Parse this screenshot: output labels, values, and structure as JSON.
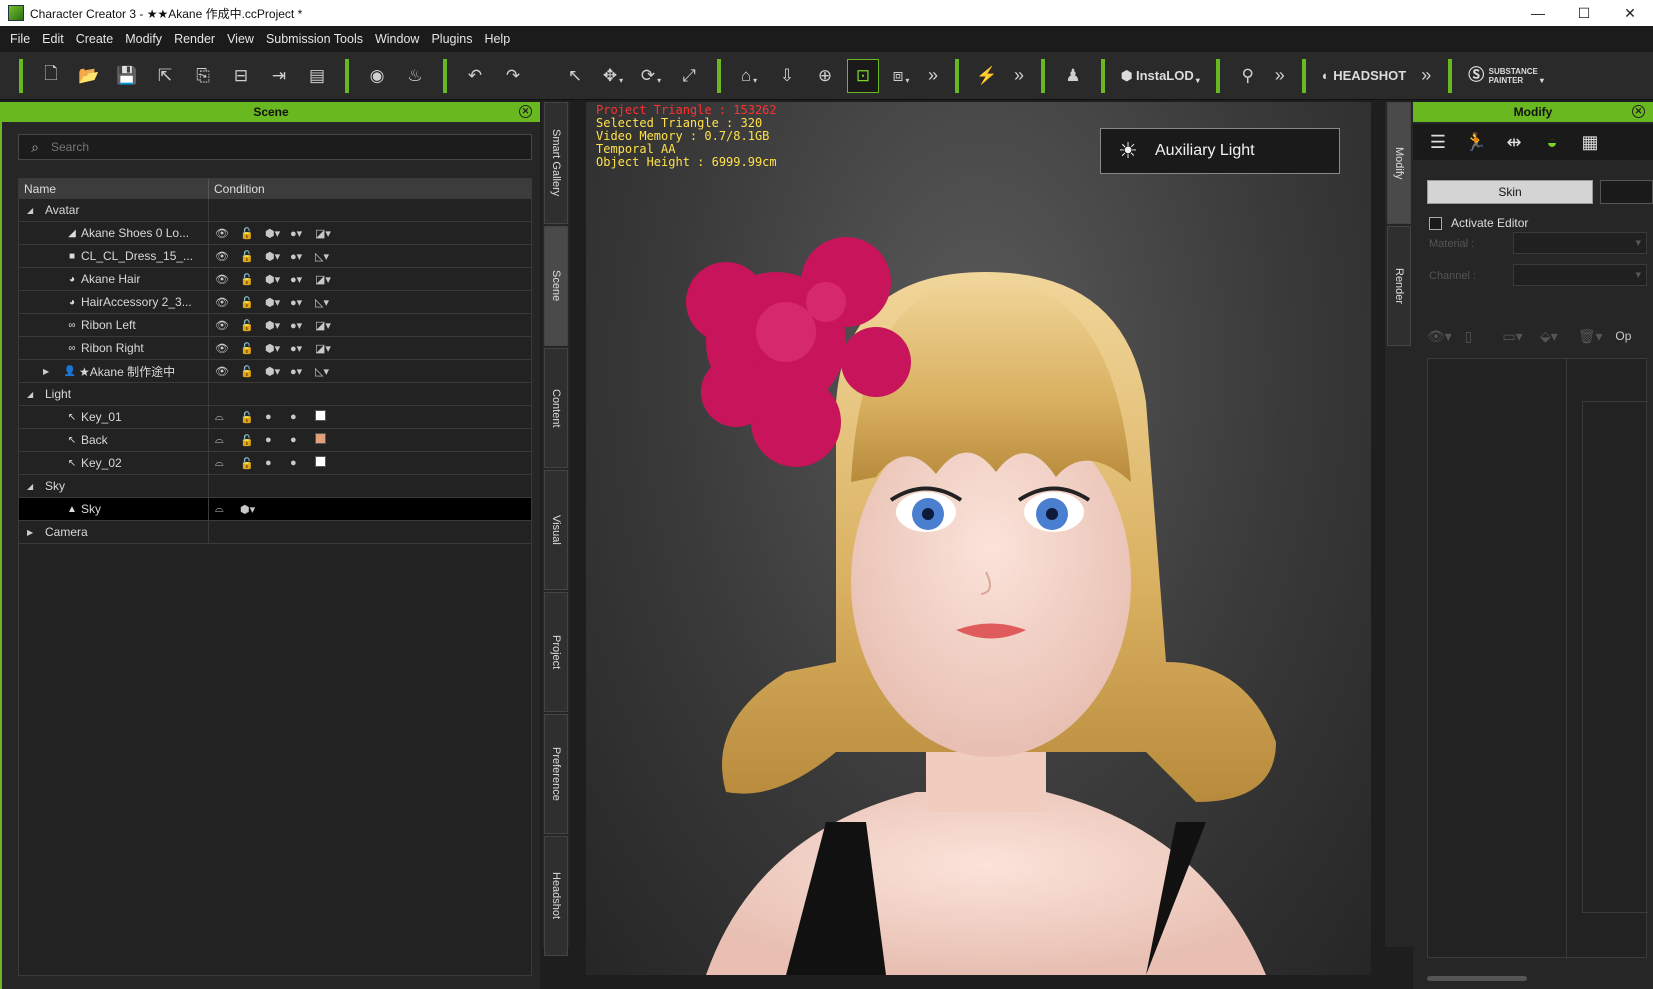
{
  "window": {
    "title": "Character Creator 3 - ★★Akane 作成中.ccProject *",
    "min_icon": "—",
    "max_icon": "☐",
    "close_icon": "✕"
  },
  "menu": [
    "File",
    "Edit",
    "Create",
    "Modify",
    "Render",
    "View",
    "Submission Tools",
    "Window",
    "Plugins",
    "Help"
  ],
  "toolbar": {
    "instalod_label": "InstaLOD",
    "headshot_label": "HEADSHOT",
    "substance_line1": "SUBSTANCE",
    "substance_line2": "PAINTER"
  },
  "scene": {
    "title": "Scene",
    "search_placeholder": "Search",
    "col_name": "Name",
    "col_condition": "Condition",
    "groups": {
      "avatar": "Avatar",
      "light": "Light",
      "sky": "Sky",
      "camera": "Camera"
    },
    "avatar_items": [
      "Akane Shoes 0 Lo...",
      "CL_CL_Dress_15_...",
      "Akane Hair",
      "HairAccessory 2_3...",
      "Ribon Left",
      "Ribon Right",
      "★Akane 制作途中"
    ],
    "light_items": [
      "Key_01",
      "Back",
      "Key_02"
    ],
    "sky_items": [
      "Sky"
    ],
    "light_colors": [
      "#ffffff",
      "#e0a07a",
      "#ffffff"
    ]
  },
  "side_tabs": [
    "Smart Gallery",
    "Scene",
    "Content",
    "Visual",
    "Project",
    "Preference",
    "Headshot"
  ],
  "viewport": {
    "stats": {
      "project_triangle": "Project Triangle : 153262",
      "selected_triangle": "Selected Triangle : 320",
      "video_memory": "Video Memory : 0.7/8.1GB",
      "temporal_aa": "Temporal AA",
      "object_height": "Object Height : 6999.99cm"
    },
    "aux_light": "Auxiliary Light"
  },
  "right_tabs": [
    "Modify",
    "Render"
  ],
  "modify": {
    "title": "Modify",
    "skin": "Skin",
    "activate_editor": "Activate Editor",
    "material_label": "Material :",
    "channel_label": "Channel :",
    "op_label": "Op"
  },
  "colors": {
    "accent": "#6ab81f",
    "stat_yellow": "#ffe14a",
    "stat_red": "#ff3030"
  }
}
